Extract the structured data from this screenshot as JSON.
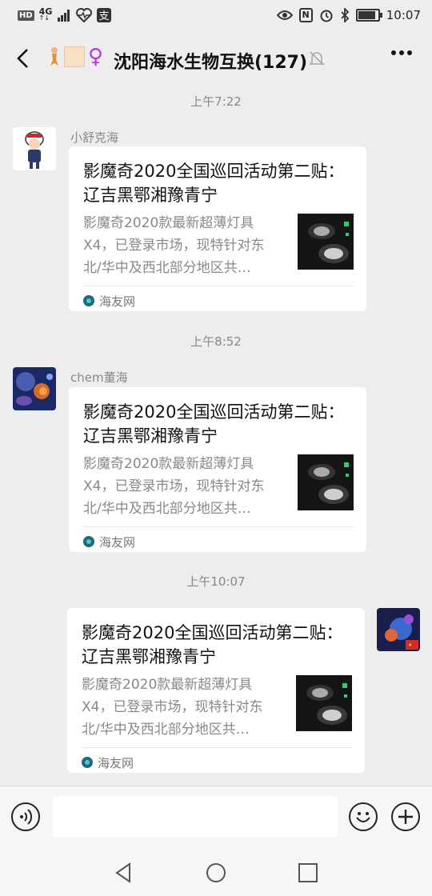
{
  "status": {
    "hd": "HD",
    "network": "4G",
    "network_sub": "↑↓",
    "nfc": "N",
    "time": "10:07"
  },
  "header": {
    "title": "沈阳海水生物互换(127)",
    "venus": "♀"
  },
  "messages": [
    {
      "time": "上午7:22",
      "sender": "小舒克海",
      "title": "影魔奇2020全国巡回活动第二贴：  辽吉黑鄂湘豫青宁",
      "desc": "影魔奇2020款最新超薄灯具X4，已登录市场，现特针对东北/华中及西北部分地区共…",
      "source": "海友网"
    },
    {
      "time": "上午8:52",
      "sender": "chem董海",
      "title": "影魔奇2020全国巡回活动第二贴：  辽吉黑鄂湘豫青宁",
      "desc": "影魔奇2020款最新超薄灯具X4，已登录市场，现特针对东北/华中及西北部分地区共…",
      "source": "海友网"
    },
    {
      "time": "上午10:07",
      "title": "影魔奇2020全国巡回活动第二贴：  辽吉黑鄂湘豫青宁",
      "desc": "影魔奇2020款最新超薄灯具X4，已登录市场，现特针对东北/华中及西北部分地区共…",
      "source": "海友网"
    }
  ],
  "input": {
    "value": ""
  }
}
